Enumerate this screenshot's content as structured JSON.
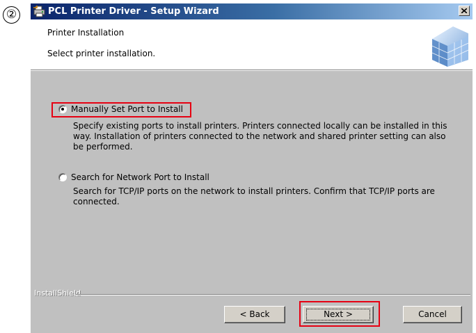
{
  "step_marker": "②",
  "window": {
    "title": "PCL Printer Driver - Setup Wizard"
  },
  "header": {
    "title": "Printer Installation",
    "subtitle": "Select printer installation."
  },
  "options": [
    {
      "label": "Manually Set Port to Install",
      "selected": true,
      "description": "Specify existing ports to install printers. Printers connected locally can be installed in this way. Installation of printers connected to the network and shared printer setting can also be performed."
    },
    {
      "label": "Search for Network Port to Install",
      "selected": false,
      "description": "Search for TCP/IP ports on the network to install printers. Confirm that TCP/IP ports are connected."
    }
  ],
  "footer": {
    "brand": "InstallShield"
  },
  "buttons": {
    "back": "< Back",
    "next": "Next >",
    "cancel": "Cancel"
  },
  "colors": {
    "highlight": "#e60012",
    "titlebar_start": "#0a246a",
    "titlebar_end": "#a6caf0",
    "dialog_bg": "#c0c0c0"
  }
}
